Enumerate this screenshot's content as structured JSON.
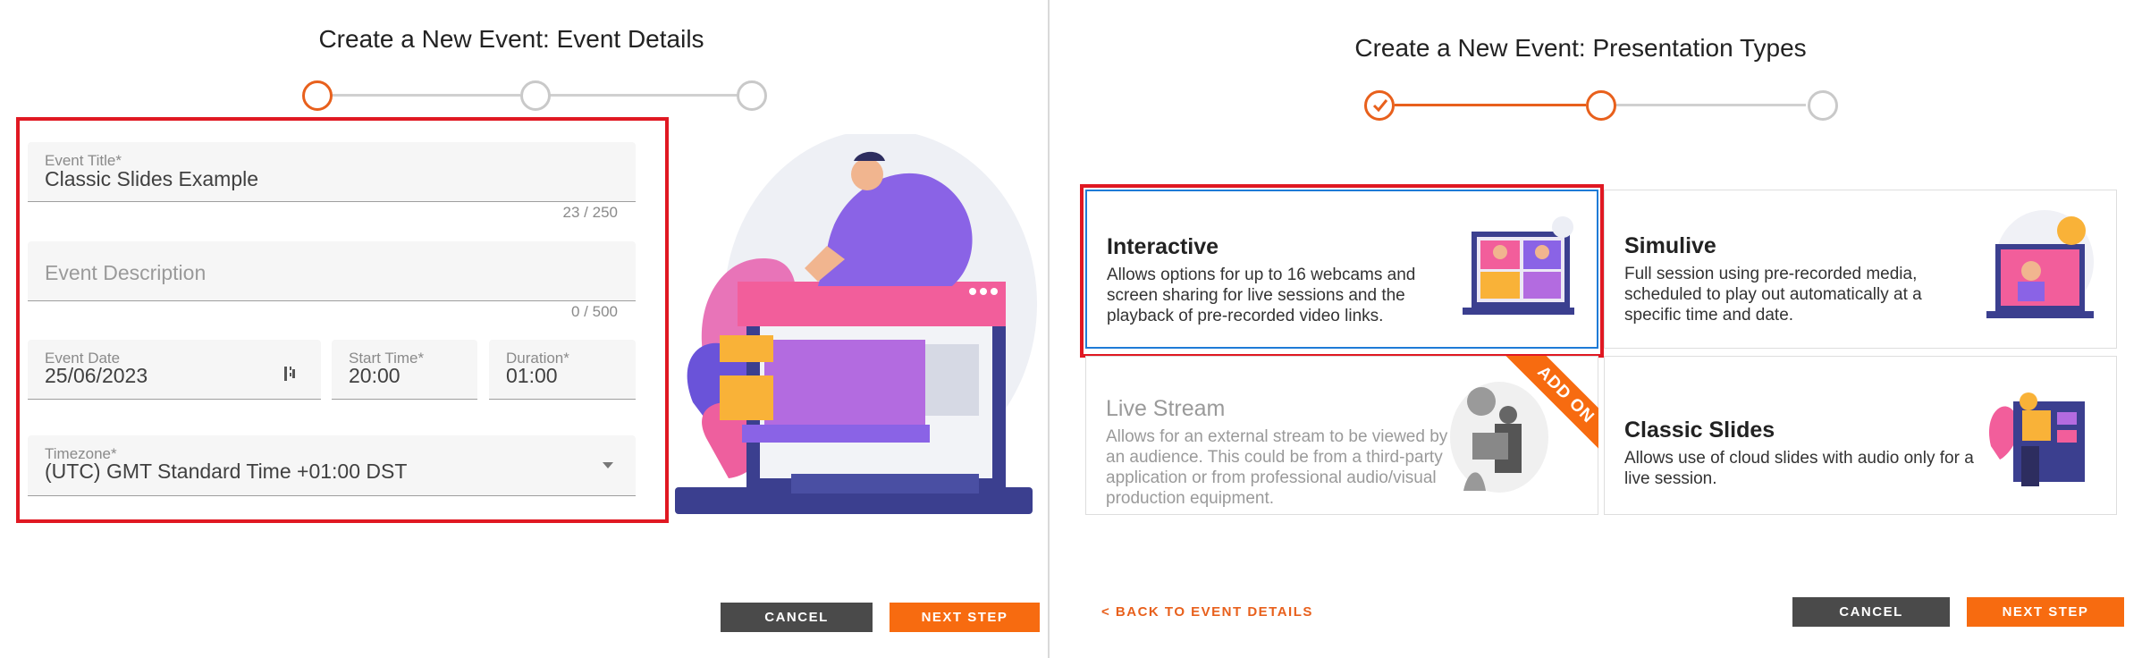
{
  "left": {
    "title": "Create a New Event: Event Details",
    "fields": {
      "event_title_label": "Event Title*",
      "event_title_value": "Classic Slides Example",
      "event_title_counter": "23 / 250",
      "description_placeholder": "Event Description",
      "description_counter": "0 / 500",
      "date_label": "Event Date",
      "date_value": "25/06/2023",
      "start_label": "Start Time*",
      "start_value": "20:00",
      "duration_label": "Duration*",
      "duration_value": "01:00",
      "timezone_label": "Timezone*",
      "timezone_value": "(UTC) GMT Standard Time +01:00 DST"
    },
    "buttons": {
      "cancel": "CANCEL",
      "next": "NEXT STEP"
    }
  },
  "right": {
    "title": "Create a New Event: Presentation Types",
    "cards": {
      "interactive": {
        "title": "Interactive",
        "desc": "Allows options for up to 16 webcams and screen sharing for live sessions and the playback of pre-recorded video links."
      },
      "simulive": {
        "title": "Simulive",
        "desc": "Full session using pre-recorded media, scheduled to play out automatically at a specific time and date."
      },
      "livestream": {
        "title": "Live Stream",
        "desc": "Allows for an external stream to be viewed by an audience. This could be from a third-party application or from professional audio/visual production equipment.",
        "badge": "ADD ON"
      },
      "classic": {
        "title": "Classic Slides",
        "desc": "Allows use of cloud slides with audio only for a live session."
      }
    },
    "back_link": "< BACK TO EVENT DETAILS",
    "buttons": {
      "cancel": "CANCEL",
      "next": "NEXT STEP"
    }
  },
  "colors": {
    "accent": "#e8601c",
    "button_orange": "#f76b10",
    "button_grey": "#4a4a4a",
    "highlight_red": "#e01822",
    "selected_blue": "#1e7bd7"
  }
}
